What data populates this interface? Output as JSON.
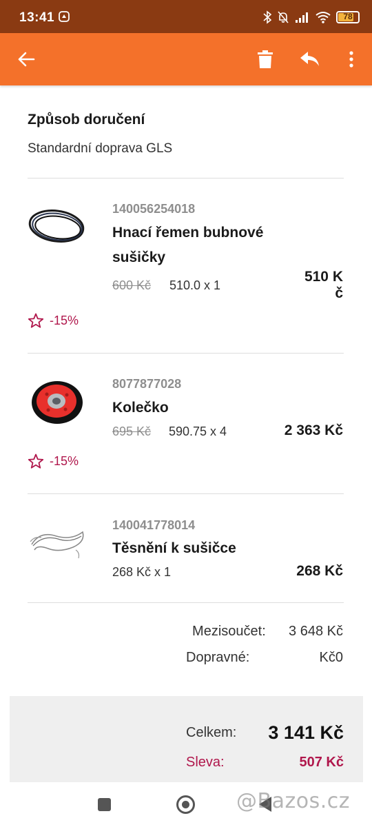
{
  "status_bar": {
    "time": "13:41",
    "battery": "78",
    "battery_level": 0.78,
    "icons": [
      "app-notification-icon",
      "bluetooth-icon",
      "bell-off-icon",
      "signal-icon",
      "wifi-icon",
      "battery-icon"
    ]
  },
  "app_bar": {
    "background": "#f4712a",
    "icons": [
      "back-arrow-icon",
      "trash-icon",
      "reply-icon",
      "more-vert-icon"
    ]
  },
  "delivery": {
    "heading": "Způsob doručení",
    "method": "Standardní doprava GLS"
  },
  "items": [
    {
      "code": "140056254018",
      "name_line1": "Hnací řemen bubnové",
      "name_line2": "sušičky",
      "old_price": "600 Kč",
      "price_qty": "510.0 x 1",
      "total_line1": "510 K",
      "total_line2": "č",
      "discount": "-15%",
      "thumb": "drive-belt-image"
    },
    {
      "code": "8077877028",
      "name": "Kolečko",
      "old_price": "695 Kč",
      "price_qty": "590.75 x 4",
      "total": "2 363 Kč",
      "discount": "-15%",
      "thumb": "wheel-image"
    },
    {
      "code": "140041778014",
      "name": "Těsnění k sušičce",
      "price_qty": "268 Kč x 1",
      "total": "268 Kč",
      "thumb": "seal-image"
    }
  ],
  "summary": {
    "subtotal_label": "Mezisoučet:",
    "subtotal_value": "3 648 Kč",
    "shipping_label": "Dopravné:",
    "shipping_value": "Kč0"
  },
  "totals": {
    "total_label": "Celkem:",
    "total_value": "3 141 Kč",
    "savings_label": "Sleva:",
    "savings_value": "507 Kč"
  },
  "nav_bar": {
    "watermark": "@Bazos.cz"
  },
  "colors": {
    "accent": "#f4712a",
    "status_bar": "#8a3a12",
    "discount": "#b0174c"
  }
}
